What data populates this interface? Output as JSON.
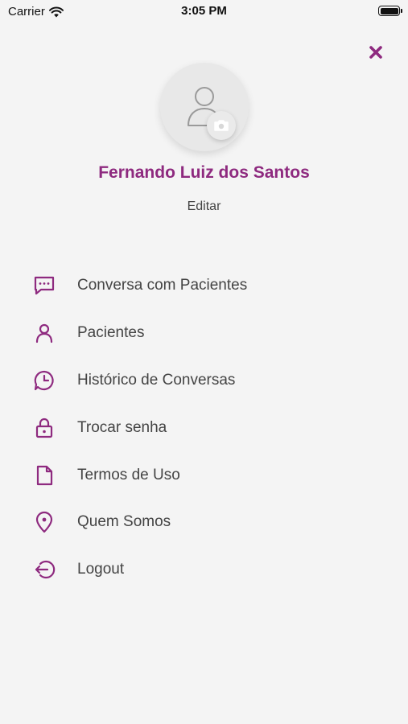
{
  "status_bar": {
    "carrier": "Carrier",
    "time": "3:05 PM",
    "wifi_icon": "wifi-icon",
    "battery_icon": "battery-icon"
  },
  "header": {
    "close_icon": "close-icon"
  },
  "profile": {
    "name": "Fernando Luiz dos Santos",
    "edit_label": "Editar",
    "avatar_icon": "user-placeholder-icon",
    "camera_icon": "camera-icon"
  },
  "menu": {
    "items": [
      {
        "label": "Conversa com Pacientes",
        "icon": "chat-bubble-icon"
      },
      {
        "label": "Pacientes",
        "icon": "person-icon"
      },
      {
        "label": "Histórico de Conversas",
        "icon": "chat-history-icon"
      },
      {
        "label": "Trocar senha",
        "icon": "lock-icon"
      },
      {
        "label": "Termos de Uso",
        "icon": "document-icon"
      },
      {
        "label": "Quem Somos",
        "icon": "location-pin-icon"
      },
      {
        "label": "Logout",
        "icon": "logout-icon"
      }
    ]
  },
  "colors": {
    "accent": "#8e2a7f",
    "background": "#f4f4f4",
    "text": "#444444"
  }
}
